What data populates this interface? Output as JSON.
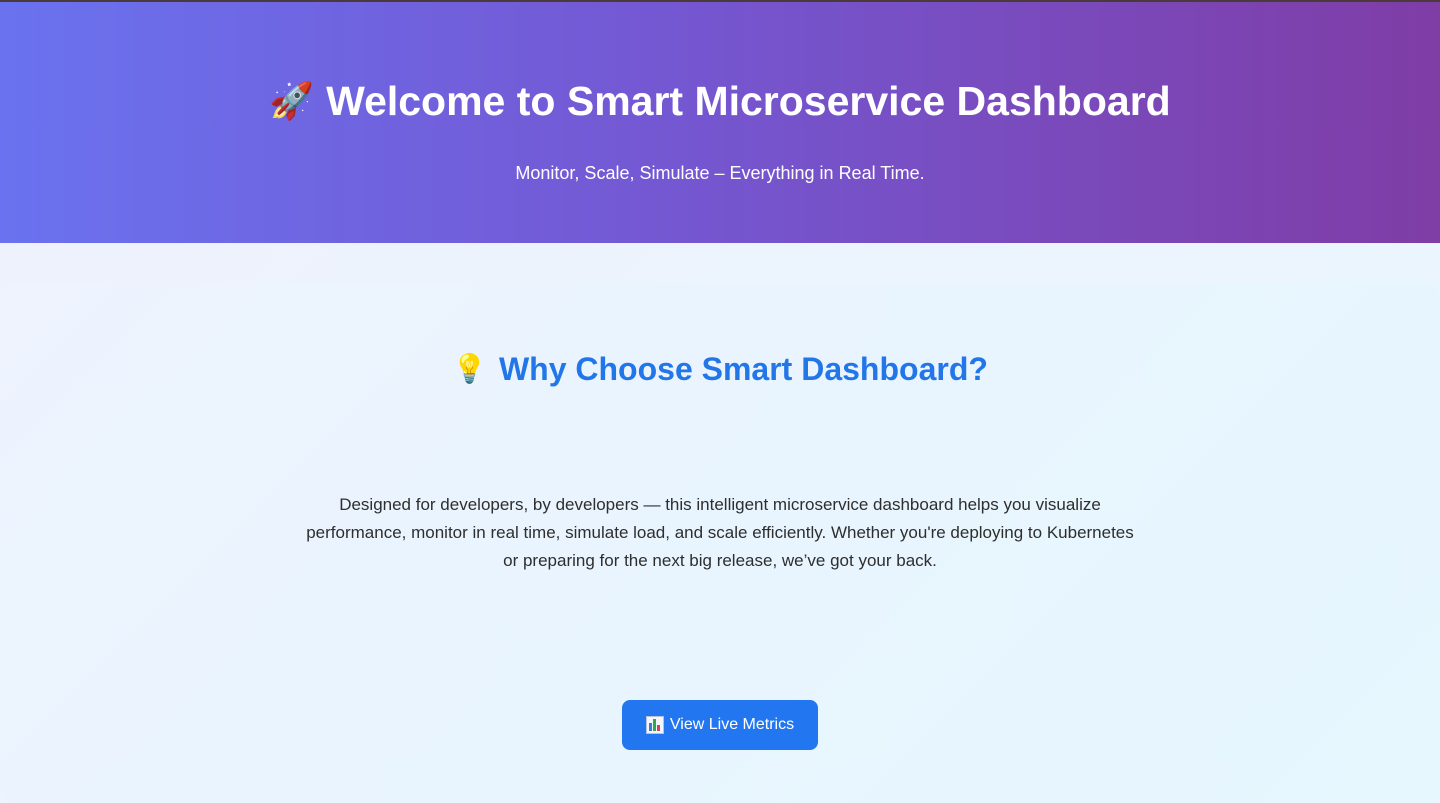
{
  "hero": {
    "icon": "🚀",
    "title": "Welcome to Smart Microservice Dashboard",
    "subtitle": "Monitor, Scale, Simulate – Everything in Real Time.",
    "gradient_start": "#6a72ef",
    "gradient_end": "#7f3da6"
  },
  "section": {
    "icon": "💡",
    "title": "Why Choose Smart Dashboard?",
    "title_color": "#2276e8",
    "description": "Designed for developers, by developers — this intelligent microservice dashboard helps you visualize performance, monitor in real time, simulate load, and scale efficiently. Whether you're deploying to Kubernetes or preparing for the next big release, we’ve got your back."
  },
  "cta": {
    "icon": "bar-chart-icon",
    "label": "View Live Metrics",
    "color": "#2276f0"
  }
}
